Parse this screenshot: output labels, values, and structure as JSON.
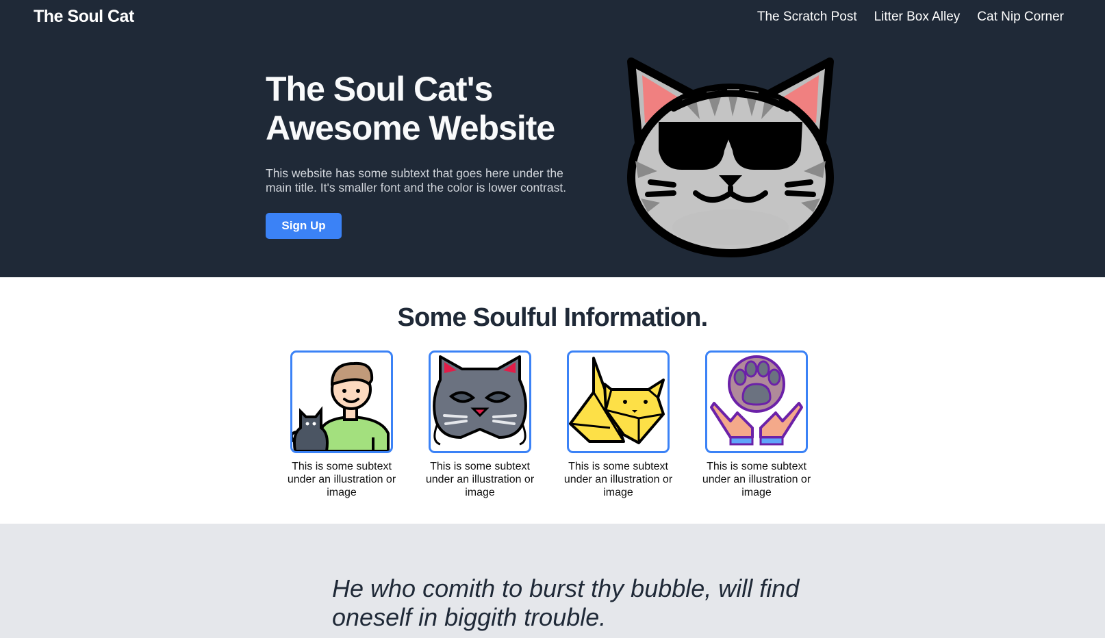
{
  "header": {
    "brand": "The Soul Cat",
    "nav": [
      "The Scratch Post",
      "Litter Box Alley",
      "Cat Nip Corner"
    ]
  },
  "hero": {
    "title": "The Soul Cat's Awesome Website",
    "subtitle": "This website has some subtext that goes here under the main title. It's smaller font and the color is lower contrast.",
    "cta_label": "Sign Up",
    "illustration_icon": "cool-cat-sunglasses-icon"
  },
  "info": {
    "heading": "Some Soulful Information.",
    "cards": [
      {
        "icon": "person-with-cat-icon",
        "caption": "This is some subtext under an illustration or image"
      },
      {
        "icon": "cat-mask-icon",
        "caption": "This is some subtext under an illustration or image"
      },
      {
        "icon": "origami-cat-icon",
        "caption": "This is some subtext under an illustration or image"
      },
      {
        "icon": "hands-holding-paw-icon",
        "caption": "This is some subtext under an illustration or image"
      }
    ]
  },
  "quote": {
    "text": "He who comith to burst thy bubble, will find oneself in biggith trouble."
  },
  "colors": {
    "header_bg": "#1f2937",
    "accent": "#3b82f6",
    "quote_bg": "#e5e7eb"
  }
}
